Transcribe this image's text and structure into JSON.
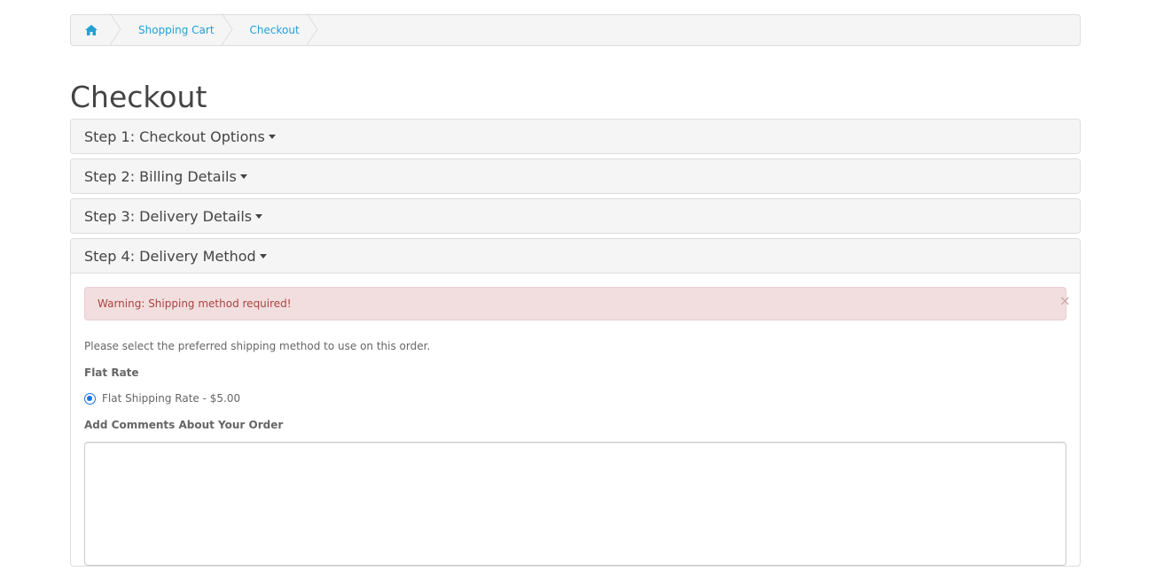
{
  "breadcrumb": {
    "home_icon": "home-icon",
    "items": [
      "Shopping Cart",
      "Checkout"
    ]
  },
  "page": {
    "title": "Checkout"
  },
  "steps": [
    {
      "label": "Step 1: Checkout Options"
    },
    {
      "label": "Step 2: Billing Details"
    },
    {
      "label": "Step 3: Delivery Details"
    },
    {
      "label": "Step 4: Delivery Method"
    }
  ],
  "delivery_method": {
    "alert": "Warning: Shipping method required!",
    "alert_close": "×",
    "intro": "Please select the preferred shipping method to use on this order.",
    "group_title": "Flat Rate",
    "option_label": "Flat Shipping Rate - $5.00",
    "option_selected": true,
    "comments_label": "Add Comments About Your Order",
    "comments_value": ""
  },
  "colors": {
    "link": "#23a1d1",
    "alert_bg": "#f2dede",
    "alert_text": "#a94442",
    "radio": "#1a73e8"
  }
}
